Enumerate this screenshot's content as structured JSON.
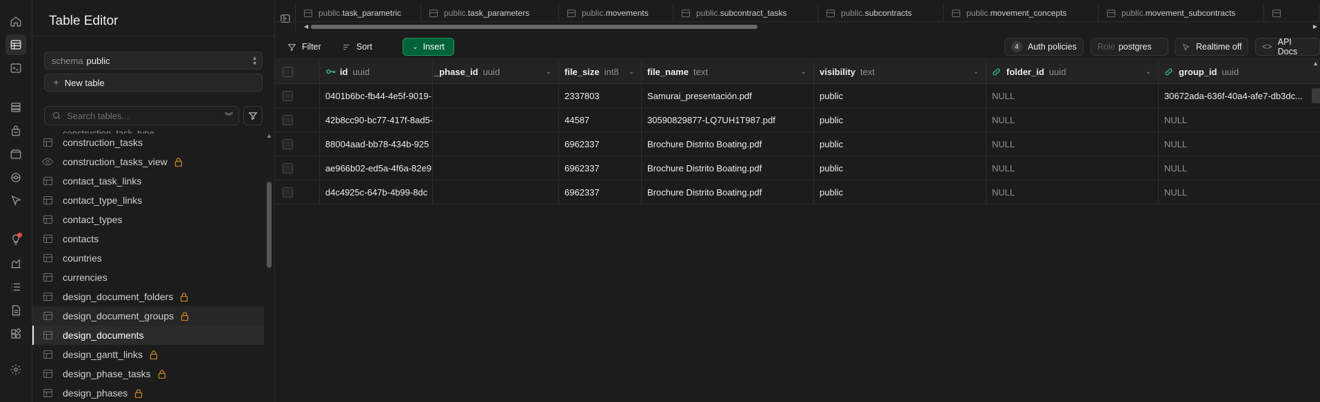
{
  "rail": {
    "icons": [
      "home-icon",
      "table-editor-icon",
      "sql-editor-icon",
      "database-icon",
      "auth-icon",
      "storage-icon",
      "realtime-icon",
      "edge-functions-icon",
      "advisors-icon",
      "reports-icon",
      "logs-icon",
      "api-docs-icon",
      "integrations-icon",
      "settings-icon"
    ]
  },
  "sidebar": {
    "title": "Table Editor",
    "schema_label": "schema",
    "schema_value": "public",
    "new_table": "New table",
    "search_placeholder": "Search tables...",
    "partial_item": "construction_task_type",
    "items": [
      {
        "label": "construction_tasks",
        "kind": "table",
        "locked": false
      },
      {
        "label": "construction_tasks_view",
        "kind": "view",
        "locked": true
      },
      {
        "label": "contact_task_links",
        "kind": "table",
        "locked": false
      },
      {
        "label": "contact_type_links",
        "kind": "table",
        "locked": false
      },
      {
        "label": "contact_types",
        "kind": "table",
        "locked": false
      },
      {
        "label": "contacts",
        "kind": "table",
        "locked": false
      },
      {
        "label": "countries",
        "kind": "table",
        "locked": false
      },
      {
        "label": "currencies",
        "kind": "table",
        "locked": false
      },
      {
        "label": "design_document_folders",
        "kind": "table",
        "locked": true
      },
      {
        "label": "design_document_groups",
        "kind": "table",
        "locked": true
      },
      {
        "label": "design_documents",
        "kind": "table",
        "locked": false
      },
      {
        "label": "design_gantt_links",
        "kind": "table",
        "locked": true
      },
      {
        "label": "design_phase_tasks",
        "kind": "table",
        "locked": true
      },
      {
        "label": "design_phases",
        "kind": "table",
        "locked": true
      }
    ]
  },
  "tabs": [
    {
      "schema": "public.",
      "name": "task_parametric"
    },
    {
      "schema": "public.",
      "name": "task_parameters"
    },
    {
      "schema": "public.",
      "name": "movements"
    },
    {
      "schema": "public.",
      "name": "subcontract_tasks"
    },
    {
      "schema": "public.",
      "name": "subcontracts"
    },
    {
      "schema": "public.",
      "name": "movement_concepts"
    },
    {
      "schema": "public.",
      "name": "movement_subcontracts"
    }
  ],
  "toolbar": {
    "filter": "Filter",
    "sort": "Sort",
    "insert": "Insert",
    "auth_count": "4",
    "auth_policies": "Auth policies",
    "role_label": "Role",
    "role_value": "postgres",
    "realtime": "Realtime off",
    "api_docs": "API Docs"
  },
  "columns": [
    {
      "name": "id",
      "type": "uuid"
    },
    {
      "name": "_phase_id",
      "type": "uuid"
    },
    {
      "name": "file_size",
      "type": "int8"
    },
    {
      "name": "file_name",
      "type": "text"
    },
    {
      "name": "visibility",
      "type": "text"
    },
    {
      "name": "folder_id",
      "type": "uuid"
    },
    {
      "name": "group_id",
      "type": "uuid"
    }
  ],
  "rows": [
    {
      "id": "0401b6bc-fb44-4e5f-9019-",
      "phase": "",
      "file_size": "2337803",
      "file_name": "Samurai_presentación.pdf",
      "visibility": "public",
      "folder_id": "NULL",
      "group_id": "30672ada-636f-40a4-afe7-db3dc..."
    },
    {
      "id": "42b8cc90-bc77-417f-8ad5-",
      "phase": "",
      "file_size": "44587",
      "file_name": "30590829877-LQ7UH1T987.pdf",
      "visibility": "public",
      "folder_id": "NULL",
      "group_id": "NULL"
    },
    {
      "id": "88004aad-bb78-434b-925",
      "phase": "",
      "file_size": "6962337",
      "file_name": "Brochure Distrito Boating.pdf",
      "visibility": "public",
      "folder_id": "NULL",
      "group_id": "NULL"
    },
    {
      "id": "ae966b02-ed5a-4f6a-82e9",
      "phase": "",
      "file_size": "6962337",
      "file_name": "Brochure Distrito Boating.pdf",
      "visibility": "public",
      "folder_id": "NULL",
      "group_id": "NULL"
    },
    {
      "id": "d4c4925c-647b-4b99-8dc",
      "phase": "",
      "file_size": "6962337",
      "file_name": "Brochure Distrito Boating.pdf",
      "visibility": "public",
      "folder_id": "NULL",
      "group_id": "NULL"
    }
  ]
}
